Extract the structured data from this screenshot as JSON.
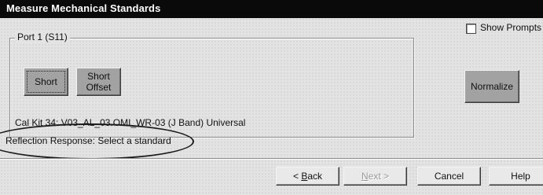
{
  "window": {
    "title": "Measure Mechanical Standards"
  },
  "group": {
    "label": "Port 1 (S11)"
  },
  "standards": [
    {
      "line1": "Short",
      "line2": ""
    },
    {
      "line1": "Short",
      "line2": "Offset"
    }
  ],
  "cal_kit_text": "Cal Kit 34: V03_AL_03.OMI_WR-03 (J Band) Universal",
  "status_text": "Reflection Response: Select a standard",
  "show_prompts": {
    "label": "Show Prompts",
    "checked": false
  },
  "normalize_label": "Normalize",
  "nav": {
    "back_prefix": "< ",
    "back_mnemonic": "B",
    "back_rest": "ack",
    "next_mnemonic": "N",
    "next_rest": "ext >",
    "cancel": "Cancel",
    "help": "Help"
  }
}
